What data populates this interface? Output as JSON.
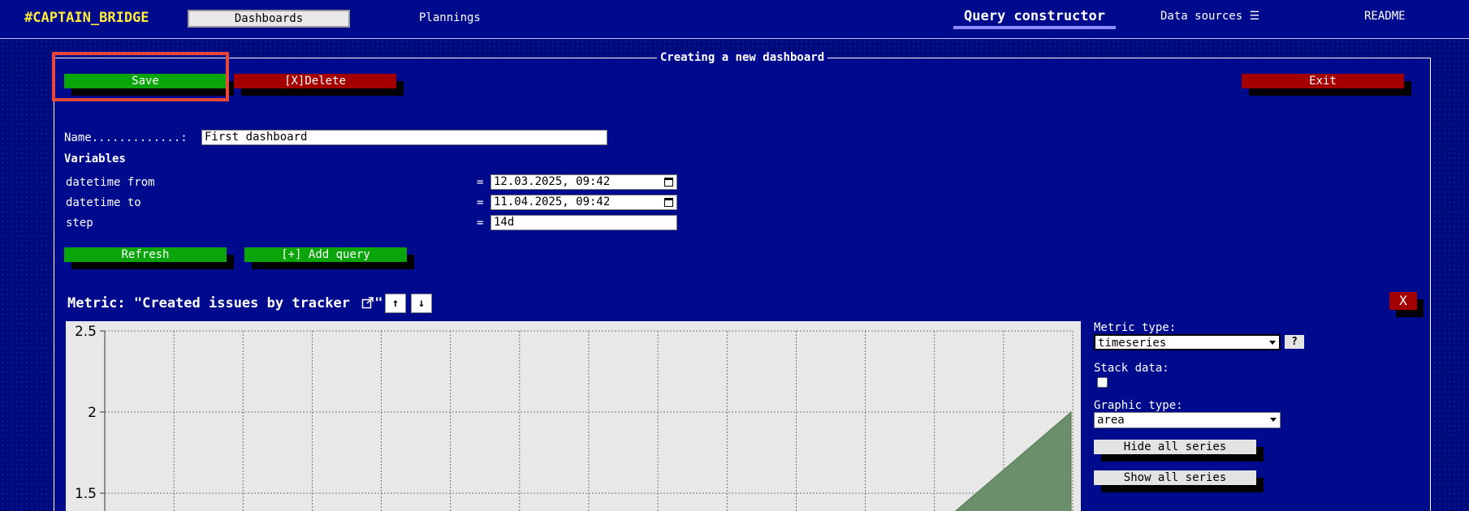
{
  "nav": {
    "brand": "#CAPTAIN_BRIDGE",
    "dashboards": "Dashboards",
    "plannings": "Plannings",
    "query_constructor": "Query constructor",
    "data_sources": "Data sources ☰",
    "readme": "README"
  },
  "panel": {
    "title": "Creating a new dashboard",
    "save": "Save",
    "delete": "[X]Delete",
    "exit": "Exit",
    "name_label": "Name.............:",
    "name_value": "First dashboard",
    "variables_label": "Variables",
    "variables": [
      {
        "name": "datetime from",
        "eq": "=",
        "value": "12.03.2025, 09:42",
        "calendar": true
      },
      {
        "name": "datetime to",
        "eq": "=",
        "value": "11.04.2025, 09:42",
        "calendar": true
      },
      {
        "name": "step",
        "eq": "=",
        "value": "14d",
        "calendar": false
      }
    ],
    "refresh": "Refresh",
    "add_query": "[+] Add query"
  },
  "metric": {
    "title": "Metric: \"Created issues by tracker ",
    "title_end": "\"",
    "up": "↑",
    "down": "↓",
    "close": "X",
    "metric_type_label": "Metric type:",
    "metric_type_value": "timeseries",
    "help": "?",
    "stack_label": "Stack data:",
    "stack_checked": false,
    "graphic_type_label": "Graphic type:",
    "graphic_type_value": "area",
    "hide_all": "Hide all series",
    "show_all": "Show all series"
  },
  "chart_data": {
    "type": "area",
    "yticks": [
      "2.5",
      "2",
      "1.5"
    ],
    "ylim": [
      1.0,
      2.5
    ],
    "series_color": "#6b8f6b",
    "visible_area_end_value": 2.0,
    "grid": true
  }
}
